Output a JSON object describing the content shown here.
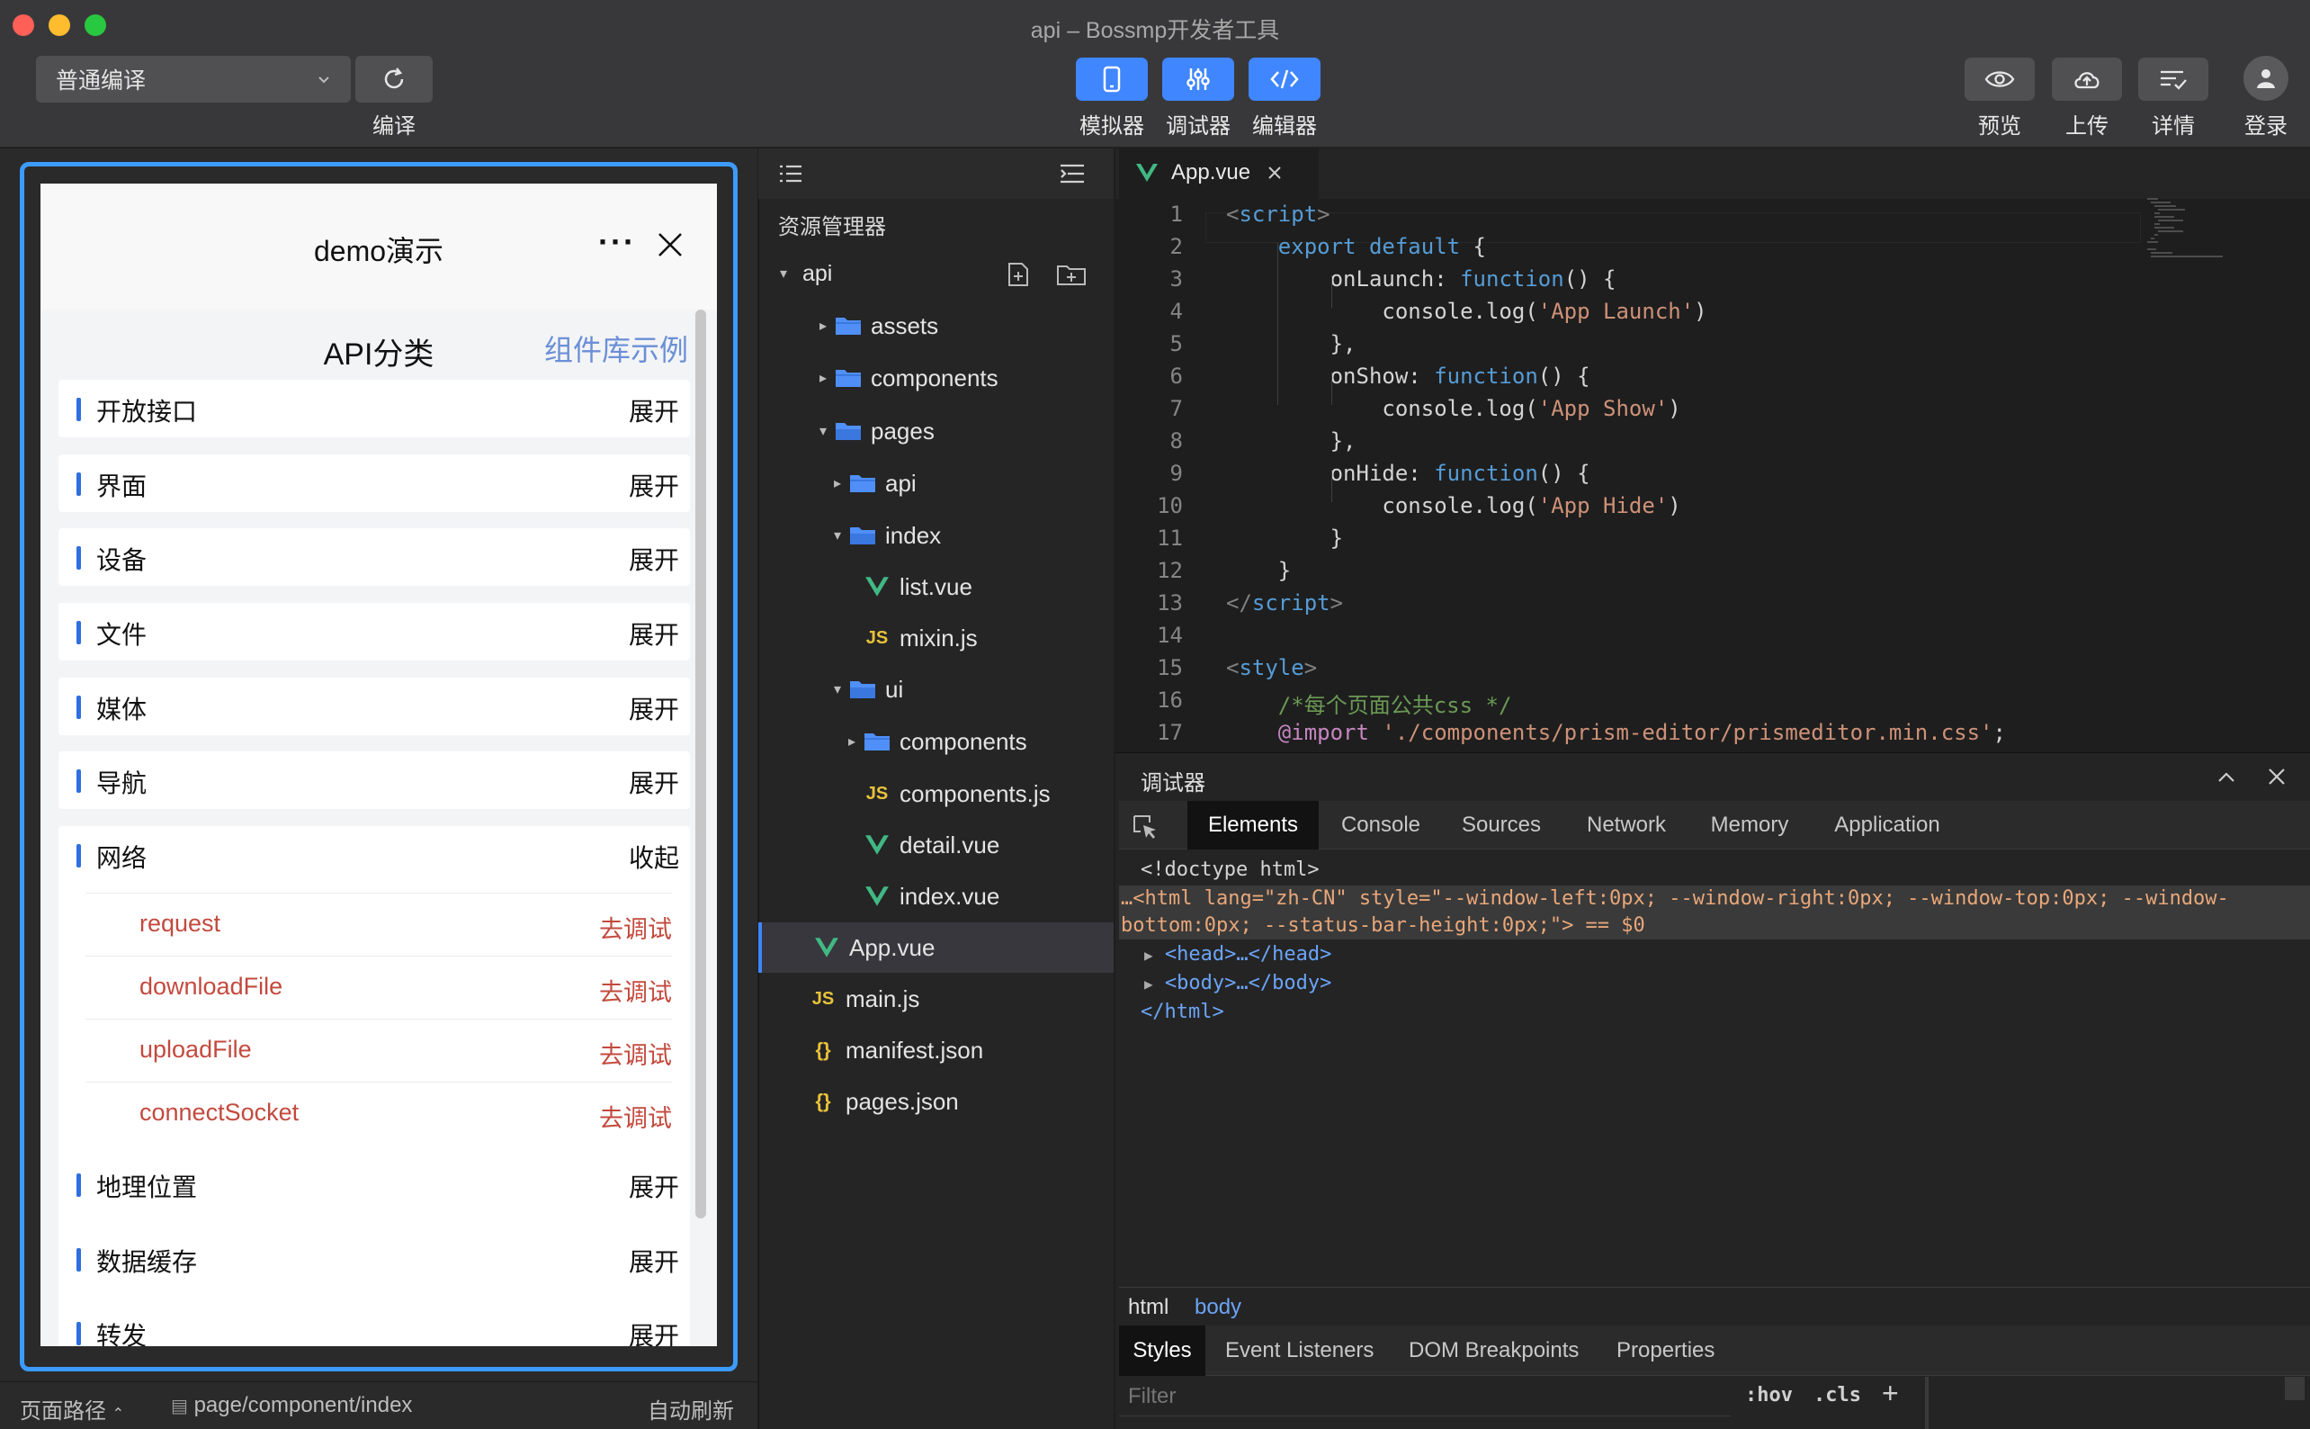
{
  "window": {
    "title": "api – Bossmp开发者工具"
  },
  "toolbar": {
    "compile_mode": "普通编译",
    "compile_label": "编译",
    "simulator_label": "模拟器",
    "debugger_label": "调试器",
    "editor_label": "编辑器",
    "preview_label": "预览",
    "upload_label": "上传",
    "details_label": "详情",
    "login_label": "登录"
  },
  "simulator": {
    "nav_title": "demo演示",
    "nav_more": "···",
    "page_title": "API分类",
    "component_link": "组件库示例",
    "categories": [
      {
        "name": "开放接口",
        "action": "展开"
      },
      {
        "name": "界面",
        "action": "展开"
      },
      {
        "name": "设备",
        "action": "展开"
      },
      {
        "name": "文件",
        "action": "展开"
      },
      {
        "name": "媒体",
        "action": "展开"
      },
      {
        "name": "导航",
        "action": "展开"
      }
    ],
    "network": {
      "name": "网络",
      "action": "收起",
      "items": [
        {
          "name": "request",
          "action": "去调试"
        },
        {
          "name": "downloadFile",
          "action": "去调试"
        },
        {
          "name": "uploadFile",
          "action": "去调试"
        },
        {
          "name": "connectSocket",
          "action": "去调试"
        }
      ]
    },
    "categories_after": [
      {
        "name": "地理位置",
        "action": "展开"
      },
      {
        "name": "数据缓存",
        "action": "展开"
      },
      {
        "name": "转发",
        "action": "展开"
      }
    ],
    "status": {
      "path_label": "页面路径",
      "path": "page/component/index",
      "auto_refresh": "自动刷新"
    }
  },
  "explorer": {
    "title": "资源管理器",
    "root": "api",
    "items": [
      {
        "label": "assets",
        "type": "folder",
        "arrow": "▸"
      },
      {
        "label": "components",
        "type": "folder",
        "arrow": "▸"
      },
      {
        "label": "pages",
        "type": "folder-open",
        "arrow": "▾"
      },
      {
        "label": "api",
        "type": "folder",
        "arrow": "▸"
      },
      {
        "label": "index",
        "type": "folder-open",
        "arrow": "▾"
      },
      {
        "label": "list.vue",
        "type": "vue",
        "arrow": ""
      },
      {
        "label": "mixin.js",
        "type": "js",
        "arrow": ""
      },
      {
        "label": "ui",
        "type": "folder-open",
        "arrow": "▾"
      },
      {
        "label": "components",
        "type": "folder",
        "arrow": "▸"
      },
      {
        "label": "components.js",
        "type": "js",
        "arrow": ""
      },
      {
        "label": "detail.vue",
        "type": "vue",
        "arrow": ""
      },
      {
        "label": "index.vue",
        "type": "vue",
        "arrow": ""
      },
      {
        "label": "App.vue",
        "type": "vue",
        "arrow": ""
      },
      {
        "label": "main.js",
        "type": "js",
        "arrow": ""
      },
      {
        "label": "manifest.json",
        "type": "json",
        "arrow": ""
      },
      {
        "label": "pages.json",
        "type": "json",
        "arrow": ""
      }
    ]
  },
  "editor": {
    "tab": "App.vue",
    "lines": [
      {
        "n": "1",
        "parts": [
          [
            "<",
            "#808080"
          ],
          [
            "script",
            "#569cd6"
          ],
          [
            ">",
            "#808080"
          ]
        ]
      },
      {
        "n": "2",
        "parts": [
          [
            "    export default ",
            "#569cd6"
          ],
          [
            "{",
            "#d4d4d4"
          ]
        ]
      },
      {
        "n": "3",
        "parts": [
          [
            "        onLaunch: ",
            "#d4d4d4"
          ],
          [
            "function",
            "#569cd6"
          ],
          [
            "() {",
            "#d4d4d4"
          ]
        ]
      },
      {
        "n": "4",
        "parts": [
          [
            "            console.log(",
            "#d4d4d4"
          ],
          [
            "'App Launch'",
            "#ce9178"
          ],
          [
            ")",
            "#d4d4d4"
          ]
        ]
      },
      {
        "n": "5",
        "parts": [
          [
            "        },",
            "#d4d4d4"
          ]
        ]
      },
      {
        "n": "6",
        "parts": [
          [
            "        onShow: ",
            "#d4d4d4"
          ],
          [
            "function",
            "#569cd6"
          ],
          [
            "() {",
            "#d4d4d4"
          ]
        ]
      },
      {
        "n": "7",
        "parts": [
          [
            "            console.log(",
            "#d4d4d4"
          ],
          [
            "'App Show'",
            "#ce9178"
          ],
          [
            ")",
            "#d4d4d4"
          ]
        ]
      },
      {
        "n": "8",
        "parts": [
          [
            "        },",
            "#d4d4d4"
          ]
        ]
      },
      {
        "n": "9",
        "parts": [
          [
            "        onHide: ",
            "#d4d4d4"
          ],
          [
            "function",
            "#569cd6"
          ],
          [
            "() {",
            "#d4d4d4"
          ]
        ]
      },
      {
        "n": "10",
        "parts": [
          [
            "            console.log(",
            "#d4d4d4"
          ],
          [
            "'App Hide'",
            "#ce9178"
          ],
          [
            ")",
            "#d4d4d4"
          ]
        ]
      },
      {
        "n": "11",
        "parts": [
          [
            "        }",
            "#d4d4d4"
          ]
        ]
      },
      {
        "n": "12",
        "parts": [
          [
            "    }",
            "#d4d4d4"
          ]
        ]
      },
      {
        "n": "13",
        "parts": [
          [
            "</",
            "#808080"
          ],
          [
            "script",
            "#569cd6"
          ],
          [
            ">",
            "#808080"
          ]
        ]
      },
      {
        "n": "14",
        "parts": []
      },
      {
        "n": "15",
        "parts": [
          [
            "<",
            "#808080"
          ],
          [
            "style",
            "#569cd6"
          ],
          [
            ">",
            "#808080"
          ]
        ]
      },
      {
        "n": "16",
        "parts": [
          [
            "    /*每个页面公共css */",
            "#6a9955"
          ]
        ]
      },
      {
        "n": "17",
        "parts": [
          [
            "    @import ",
            "#c586c0"
          ],
          [
            "'./components/prism-editor/prismeditor.min.css'",
            "#ce9178"
          ],
          [
            ";",
            "#d4d4d4"
          ]
        ]
      }
    ]
  },
  "debugger": {
    "title": "调试器",
    "tabs": [
      "Elements",
      "Console",
      "Sources",
      "Network",
      "Memory",
      "Application"
    ],
    "dom": {
      "doctype": "<!doctype html>",
      "html_open_1": "…<html lang=\"zh-CN\" style=\"--window-left:0px; --window-right:0px; --window-top:0px; --window-",
      "html_open_2": "bottom:0px; --status-bar-height:0px;\"> == $0",
      "head": "<head>…</head>",
      "body": "<body>…</body>",
      "html_close": "</html>"
    },
    "breadcrumbs": [
      "html",
      "body"
    ],
    "style_tabs": [
      "Styles",
      "Event Listeners",
      "DOM Breakpoints",
      "Properties"
    ],
    "filter_placeholder": "Filter",
    "hov": ":hov",
    "cls": ".cls",
    "add": "+"
  },
  "colors": {
    "accent": "#3f86ff",
    "vue_green": "#41b883",
    "folder": "#4f8ff7",
    "js_yellow": "#e8c23a",
    "json_yellow": "#e8c23a",
    "link_red": "#c34a3e"
  }
}
